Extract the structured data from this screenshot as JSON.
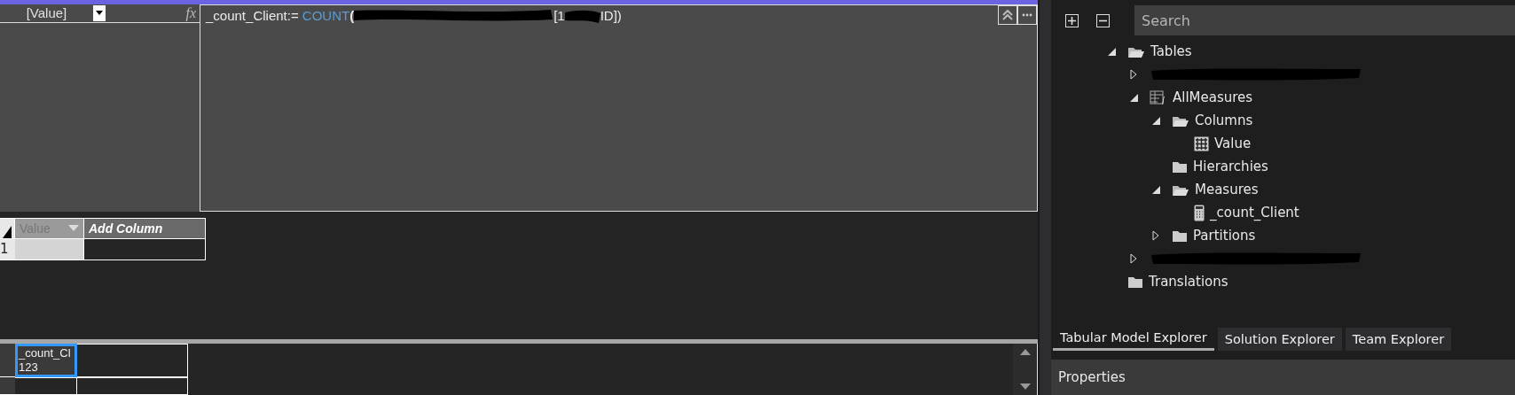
{
  "formula_bar": {
    "name_box": "[Value]",
    "fx": "fx",
    "formula": {
      "name": "_count_Client:= ",
      "function": "COUNT",
      "open": "(",
      "visible_part": "[1",
      "tail": "ID])"
    }
  },
  "grid": {
    "columns": [
      {
        "label": "Value",
        "kind": "column"
      },
      {
        "label": "Add Column",
        "kind": "add"
      }
    ],
    "rows": [
      {
        "number": "1"
      }
    ]
  },
  "measure_grid": {
    "cell": {
      "name": "_count_Cl",
      "value": "123",
      "selected": true
    }
  },
  "explorer": {
    "search": {
      "placeholder": "Search"
    },
    "tree": [
      {
        "label": "Tables",
        "kind": "folder",
        "expanded": true,
        "children": [
          {
            "kind": "redacted",
            "expanded": false
          },
          {
            "label": "AllMeasures",
            "kind": "measure-table",
            "expanded": true,
            "children": [
              {
                "label": "Columns",
                "kind": "folder",
                "expanded": true,
                "children": [
                  {
                    "label": "Value",
                    "kind": "column"
                  }
                ]
              },
              {
                "label": "Hierarchies",
                "kind": "folder"
              },
              {
                "label": "Measures",
                "kind": "folder",
                "expanded": true,
                "children": [
                  {
                    "label": "_count_Client",
                    "kind": "measure"
                  }
                ]
              },
              {
                "label": "Partitions",
                "kind": "folder",
                "expanded": false
              }
            ]
          },
          {
            "kind": "redacted",
            "expanded": false
          }
        ]
      },
      {
        "label": "Translations",
        "kind": "folder"
      }
    ],
    "tabs": [
      {
        "label": "Tabular Model Explorer",
        "selected": true
      },
      {
        "label": "Solution Explorer",
        "selected": false
      },
      {
        "label": "Team Explorer",
        "selected": false
      }
    ],
    "properties_title": "Properties"
  }
}
